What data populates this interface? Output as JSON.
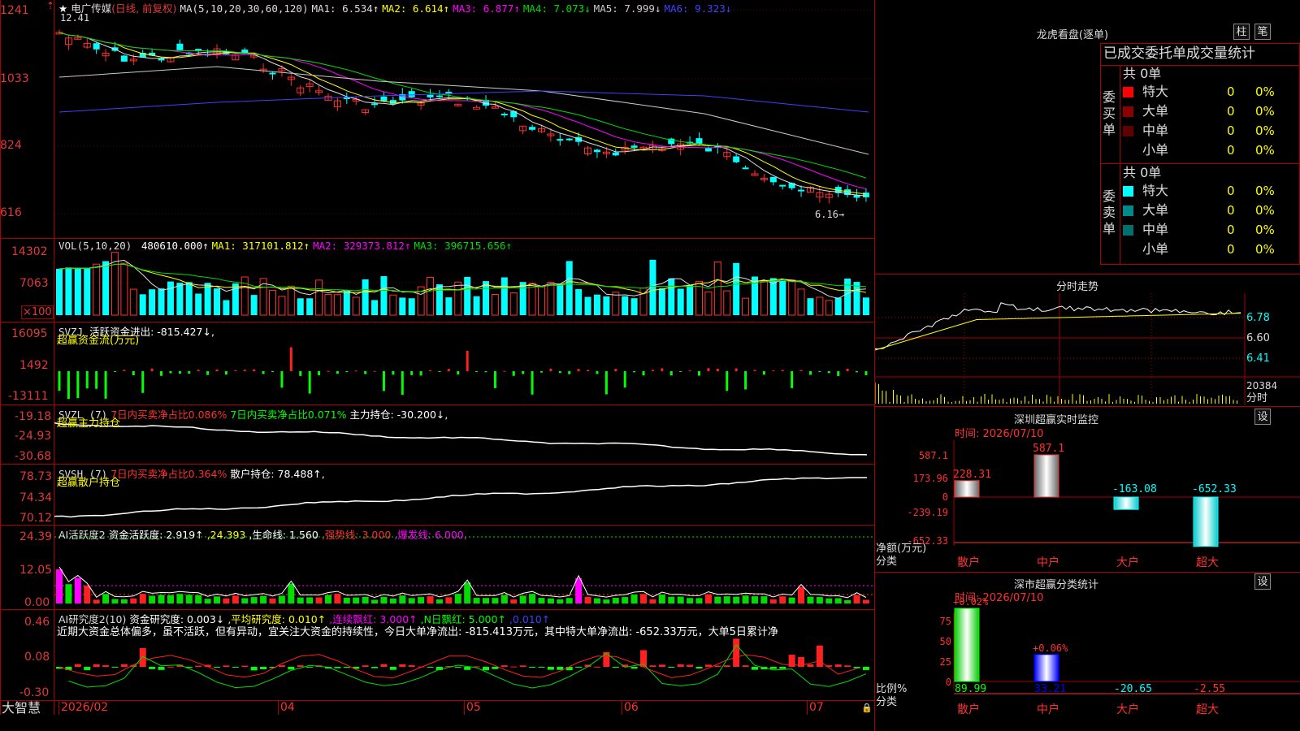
{
  "main_panel": {
    "star": "★",
    "name": "电广传媒",
    "mode": "(日线, 前复权)",
    "ma_label": "MA(5,10,20,30,60,120)",
    "ma": [
      {
        "label": "MA1:",
        "value": "6.534↑",
        "color": "#dddddd"
      },
      {
        "label": "MA2:",
        "value": "6.614↑",
        "color": "#ffff00"
      },
      {
        "label": "MA3:",
        "value": "6.877↑",
        "color": "#ff00ff"
      },
      {
        "label": "MA4:",
        "value": "7.073↓",
        "color": "#00dd00"
      },
      {
        "label": "MA5:",
        "value": "7.999↓",
        "color": "#cccccc"
      },
      {
        "label": "MA6:",
        "value": "9.323↓",
        "color": "#4040ff"
      }
    ],
    "yticks": [
      "1241",
      "1033",
      "824",
      "616"
    ],
    "high_label": "12.41",
    "low_label": "6.16→",
    "arrow_up": "⇡",
    "lock": "🔒"
  },
  "vol_panel": {
    "label": "VOL(5,10,20)",
    "value": "480610.000↑",
    "ma1": "MA1: 317101.812↑",
    "ma2": "MA2: 329373.812↑",
    "ma3": "MA3: 396715.656↑",
    "yticks": [
      "14302",
      "7063"
    ],
    "unit": "×100"
  },
  "svzj_panel": {
    "label": "SVZJ",
    "line1": "活跃资金进出: -815.427↓,",
    "line2": "超赢资金流(万元)",
    "yticks": [
      "16095",
      "1492",
      "-13111"
    ]
  },
  "svzl_panel": {
    "label": "SVZL (7)",
    "t1": "7日内买卖净占比0.086%",
    "t2": "7日内买卖净占比0.071%",
    "t3": "主力持仓: -30.200↓,",
    "line2": "超赢主力持仓",
    "yticks": [
      "-19.18",
      "-24.93",
      "-30.68"
    ]
  },
  "svsh_panel": {
    "label": "SVSH (7)",
    "t1": "7日内买卖净占比0.364%",
    "t2": "散户持仓: 78.488↑,",
    "line2": "超赢散户持仓",
    "yticks": [
      "78.73",
      "74.34",
      "70.12"
    ]
  },
  "ai1_panel": {
    "label": "AI活跃度2",
    "t1": "资金活跃度: 2.919↑",
    "t2": ",24.393",
    "t3": ",生命线: 1.560",
    "t4": ",强势线: 3.000",
    "t5": ",爆发线: 6.000,",
    "yticks": [
      "24.39",
      "12.05",
      "0.00"
    ]
  },
  "ai2_panel": {
    "label": "AI研究度2(10)",
    "t1": "资金研究度: 0.003↓",
    "t2": ",平均研究度: 0.010↑",
    "t3": ",连续飘红: 3.000↑",
    "t4": ",N日飘红: 5.000↑",
    "t5": ",0.010↑",
    "comment": "近期大资金总体偏多，虽不活跃，但有异动，宜关注大资金的持续性，今日大单净流出: -815.413万元，其中特大单净流出: -652.33万元，大单5日累计净",
    "yticks": [
      "0.46",
      "0.08",
      "-0.30"
    ]
  },
  "bottom_axis": {
    "logo": "大智慧",
    "months": [
      "2026/02",
      "04",
      "05",
      "06",
      "07"
    ]
  },
  "dragon_panel": {
    "title": "龙虎看盘(逐单)",
    "btn1": "柱",
    "btn2": "笔",
    "tab": "已成交委托单成交量统计",
    "buy": {
      "label": "委买单",
      "total": "共 0单",
      "rows": [
        {
          "name": "特大",
          "count": "0",
          "pct": "0%",
          "color": "#ff0000"
        },
        {
          "name": "大单",
          "count": "0",
          "pct": "0%",
          "color": "#8b0000"
        },
        {
          "name": "中单",
          "count": "0",
          "pct": "0%",
          "color": "#600000"
        },
        {
          "name": "小单",
          "count": "0",
          "pct": "0%",
          "color": "#000000"
        }
      ]
    },
    "sell": {
      "label": "委卖单",
      "total": "共 0单",
      "rows": [
        {
          "name": "特大",
          "count": "0",
          "pct": "0%",
          "color": "#00ffff"
        },
        {
          "name": "大单",
          "count": "0",
          "pct": "0%",
          "color": "#008b8b"
        },
        {
          "name": "中单",
          "count": "0",
          "pct": "0%",
          "color": "#006f6f"
        },
        {
          "name": "小单",
          "count": "0",
          "pct": "0%",
          "color": "#000000"
        }
      ]
    }
  },
  "intraday_panel": {
    "title": "分时走势",
    "yticks": [
      "6.78",
      "6.60",
      "6.41"
    ],
    "vol_label": "20384",
    "vol_label2": "分时"
  },
  "sz_monitor": {
    "title": "深圳超赢实时监控",
    "btn": "设",
    "time": "时间: 2026/07/10",
    "yticks": [
      "587.1",
      "173.96",
      "0",
      "-239.19",
      "-652.33"
    ],
    "unit": "净额(万元)",
    "cat_label": "分类",
    "categories": [
      "散户",
      "中户",
      "大户",
      "超大"
    ],
    "values": [
      228.31,
      587.1,
      -163.08,
      -652.33
    ],
    "value_labels": [
      "228.31",
      "587.1",
      "-163.08",
      "-652.33"
    ]
  },
  "sz_class": {
    "title": "深市超赢分类统计",
    "btn": "设",
    "time": "时间: 2026/07/10",
    "yticks": [
      "75",
      "50",
      "25",
      "0"
    ],
    "unit": "比例%",
    "cat_label": "分类",
    "categories": [
      "散户",
      "中户",
      "大户",
      "超大"
    ],
    "top_labels": [
      "+0.02%",
      "+0.06%"
    ],
    "values": [
      89.99,
      33.21,
      -20.65,
      -2.55
    ],
    "value_labels": [
      "89.99",
      "33.21",
      "-20.65",
      "-2.55"
    ]
  },
  "colors": {
    "up": "#ff3030",
    "down": "#00ffff",
    "grid": "#aa0000"
  }
}
